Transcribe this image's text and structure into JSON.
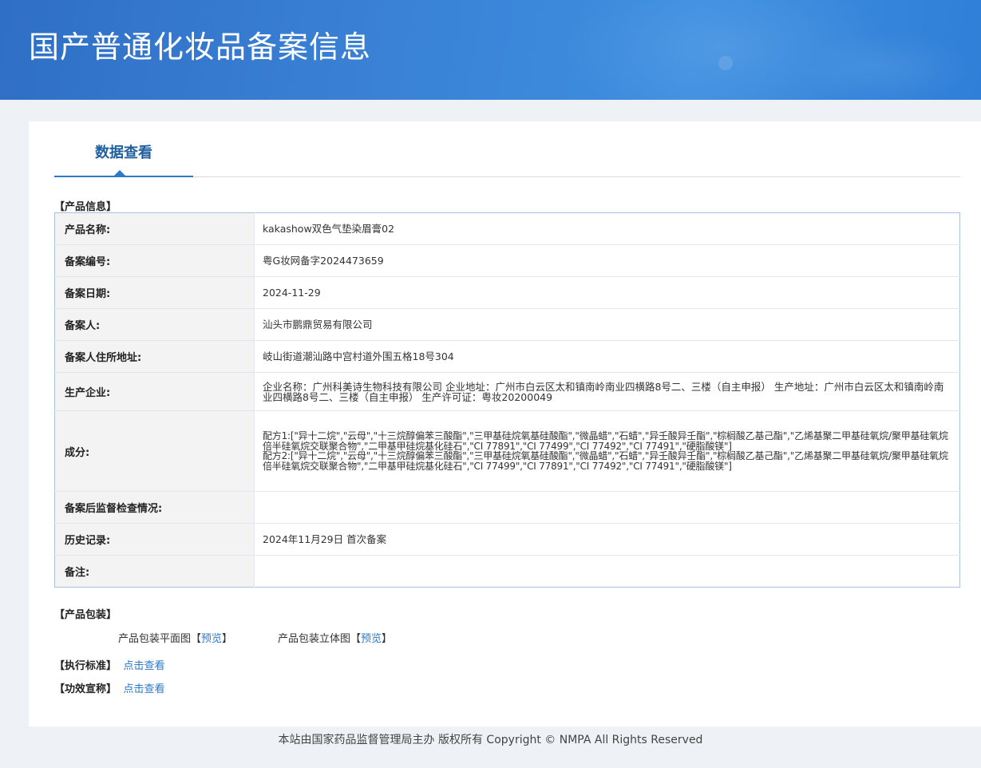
{
  "header": {
    "title": "国产普通化妆品备案信息"
  },
  "tabs": [
    {
      "label": "数据查看"
    }
  ],
  "product_info": {
    "section_title": "【产品信息】",
    "rows": [
      {
        "label": "产品名称:",
        "value": "kakashow双色气垫染眉膏02"
      },
      {
        "label": "备案编号:",
        "value": "粤G妆网备字2024473659"
      },
      {
        "label": "备案日期:",
        "value": "2024-11-29"
      },
      {
        "label": "备案人:",
        "value": "汕头市鹏鼎贸易有限公司"
      },
      {
        "label": "备案人住所地址:",
        "value": "岐山街道潮汕路中宫村道外围五格18号304"
      },
      {
        "label": "生产企业:",
        "value": "企业名称：广州科美诗生物科技有限公司 企业地址：广州市白云区太和镇南岭南业四横路8号二、三楼（自主申报） 生产地址：广州市白云区太和镇南岭南业四横路8号二、三楼（自主申报） 生产许可证：粤妆20200049"
      },
      {
        "label": "成分:",
        "value": "配方1:[\"异十二烷\",\"云母\",\"十三烷醇偏苯三酸酯\",\"三甲基硅烷氧基硅酸酯\",\"微晶蜡\",\"石蜡\",\"异壬酸异壬酯\",\"棕榈酸乙基己酯\",\"乙烯基聚二甲基硅氧烷/聚甲基硅氧烷倍半硅氧烷交联聚合物\",\"二甲基甲硅烷基化硅石\",\"CI 77891\",\"CI 77499\",\"CI 77492\",\"CI 77491\",\"硬脂酸镁\"]\n配方2:[\"异十二烷\",\"云母\",\"十三烷醇偏苯三酸酯\",\"三甲基硅烷氧基硅酸酯\",\"微晶蜡\",\"石蜡\",\"异壬酸异壬酯\",\"棕榈酸乙基己酯\",\"乙烯基聚二甲基硅氧烷/聚甲基硅氧烷倍半硅氧烷交联聚合物\",\"二甲基甲硅烷基化硅石\",\"CI 77499\",\"CI 77891\",\"CI 77492\",\"CI 77491\",\"硬脂酸镁\"]"
      },
      {
        "label": "备案后监督检查情况:",
        "value": ""
      },
      {
        "label": "历史记录:",
        "value": "2024年11月29日 首次备案"
      },
      {
        "label": "备注:",
        "value": ""
      }
    ]
  },
  "packaging": {
    "section_title": "【产品包装】",
    "flat_label": "产品包装平面图",
    "flat_bracket_open": "【",
    "flat_link": "预览",
    "flat_bracket_close": "】",
    "solid_label": "产品包装立体图",
    "solid_bracket_open": "【",
    "solid_link": "预览",
    "solid_bracket_close": "】"
  },
  "standard": {
    "section_title": "【执行标准】",
    "link": "点击查看"
  },
  "efficacy": {
    "section_title": "【功效宣称】",
    "link": "点击查看"
  },
  "footer": {
    "text": "本站由国家药品监督管理局主办 版权所有 Copyright © NMPA All Rights Reserved"
  }
}
